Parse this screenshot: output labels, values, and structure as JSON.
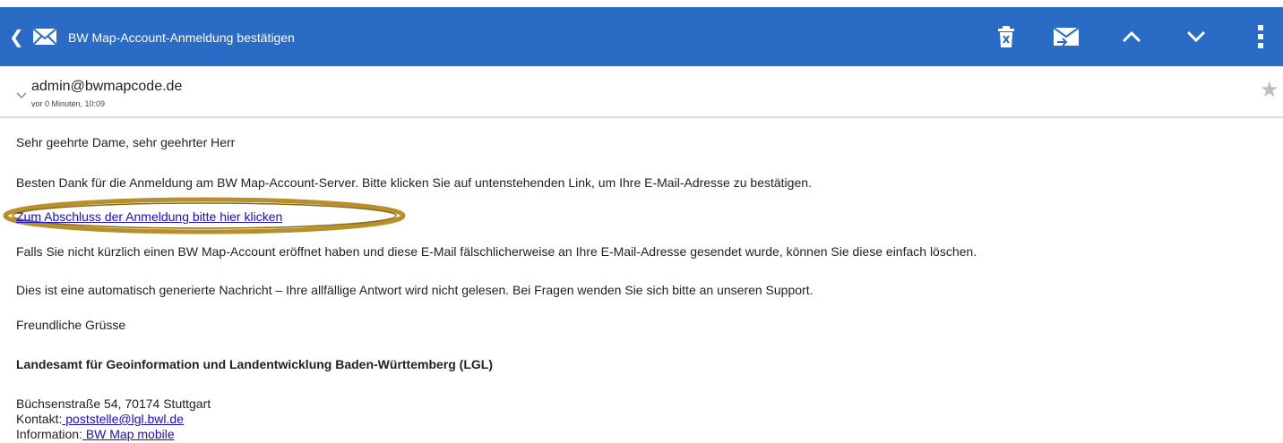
{
  "appbar": {
    "title": "BW Map-Account-Anmeldung bestätigen",
    "back_glyph": "❮",
    "background": "#2a6bc6",
    "icons": [
      "back-icon",
      "mail-icon",
      "delete-icon",
      "mark-unread-icon",
      "previous-icon",
      "next-icon",
      "overflow-menu-icon"
    ]
  },
  "header": {
    "sender": "admin@bwmapcode.de",
    "time": "vor 0 Minuten, 10:09"
  },
  "body": {
    "greeting": "Sehr geehrte Dame, sehr geehrter Herr",
    "thanks": "Besten Dank für die Anmeldung am BW Map-Account-Server. Bitte klicken Sie auf untenstehenden Link, um Ihre E-Mail-Adresse zu bestätigen.",
    "confirm_link": "Zum Abschluss der Anmeldung bitte hier klicken",
    "ignore": "Falls Sie nicht kürzlich einen BW Map-Account eröffnet haben und diese E-Mail fälschlicherweise an Ihre E-Mail-Adresse gesendet wurde, können Sie diese einfach löschen.",
    "auto": "Dies ist eine automatisch generierte Nachricht – Ihre allfällige Antwort wird nicht gelesen. Bei Fragen wenden Sie sich bitte an unseren Support.",
    "closing": "Freundliche Grüsse",
    "org": "Landesamt für Geoinformation und Landentwicklung Baden-Württemberg (LGL)",
    "address": "Büchsenstraße 54, 70174 Stuttgart",
    "contact_label": "Kontakt:",
    "contact_link": " poststelle@lgl.bwl.de",
    "info_label": "Information:",
    "info_link": " BW Map mobile"
  },
  "colors": {
    "accent": "#2a6bc6",
    "link": "#1a0dcc",
    "highlight_ring": "#b8902a"
  }
}
